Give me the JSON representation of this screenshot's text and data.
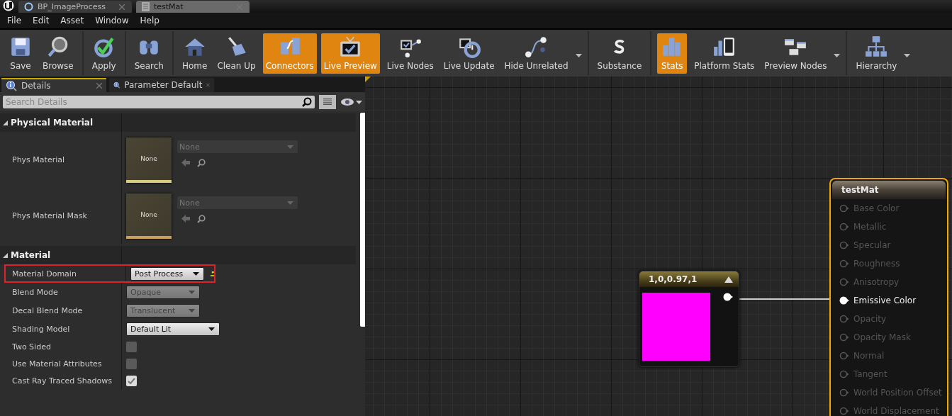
{
  "tabs": [
    {
      "label": "BP_ImageProcess",
      "selected": false
    },
    {
      "label": "testMat",
      "selected": true
    }
  ],
  "menu": [
    "File",
    "Edit",
    "Asset",
    "Window",
    "Help"
  ],
  "toolbar": [
    [
      {
        "label": "Save",
        "active": false,
        "dropdown": false
      },
      {
        "label": "Browse",
        "active": false,
        "dropdown": false
      }
    ],
    [
      {
        "label": "Apply",
        "active": false,
        "dropdown": false
      }
    ],
    [
      {
        "label": "Search",
        "active": false,
        "dropdown": false
      }
    ],
    [
      {
        "label": "Home",
        "active": false,
        "dropdown": false
      },
      {
        "label": "Clean Up",
        "active": false,
        "dropdown": false
      },
      {
        "label": "Connectors",
        "active": true,
        "dropdown": false
      },
      {
        "label": "Live Preview",
        "active": true,
        "dropdown": false
      },
      {
        "label": "Live Nodes",
        "active": false,
        "dropdown": false
      },
      {
        "label": "Live Update",
        "active": false,
        "dropdown": false
      },
      {
        "label": "Hide Unrelated",
        "active": false,
        "dropdown": true
      }
    ],
    [
      {
        "label": "Substance",
        "active": false,
        "dropdown": false
      }
    ],
    [
      {
        "label": "Stats",
        "active": true,
        "dropdown": false
      },
      {
        "label": "Platform Stats",
        "active": false,
        "dropdown": false
      },
      {
        "label": "Preview Nodes",
        "active": false,
        "dropdown": true
      }
    ],
    [
      {
        "label": "Hierarchy",
        "active": false,
        "dropdown": true
      }
    ]
  ],
  "details": {
    "tabs": [
      {
        "label": "Details",
        "selected": true
      },
      {
        "label": "Parameter Default",
        "selected": false
      }
    ],
    "search": {
      "placeholder": "Search Details"
    },
    "sections": [
      {
        "title": "Physical Material",
        "expanded": true,
        "rows": [
          {
            "kind": "asset",
            "label": "Phys Material",
            "thumb_label": "None",
            "value": "None",
            "color": "#d8cc80"
          },
          {
            "kind": "asset",
            "label": "Phys Material Mask",
            "thumb_label": "None",
            "value": "None",
            "color": "#c9a060"
          }
        ]
      },
      {
        "title": "Material",
        "expanded": true,
        "rows": [
          {
            "kind": "combo",
            "label": "Material Domain",
            "value": "Post Process",
            "disabled": false,
            "highlighted": true,
            "reset": true
          },
          {
            "kind": "combo",
            "label": "Blend Mode",
            "value": "Opaque",
            "disabled": true,
            "highlighted": false,
            "reset": false
          },
          {
            "kind": "combo",
            "label": "Decal Blend Mode",
            "value": "Translucent",
            "disabled": true,
            "highlighted": false,
            "reset": false
          },
          {
            "kind": "combo",
            "label": "Shading Model",
            "value": "Default Lit",
            "disabled": false,
            "highlighted": false,
            "reset": false,
            "wide": true
          },
          {
            "kind": "checkbox",
            "label": "Two Sided",
            "checked": false
          },
          {
            "kind": "checkbox",
            "label": "Use Material Attributes",
            "checked": false
          },
          {
            "kind": "checkbox",
            "label": "Cast Ray Traced Shadows",
            "checked": true
          }
        ]
      }
    ]
  },
  "graph": {
    "constant_node": {
      "title": "1,0,0.97,1",
      "color": "#ff00ff"
    },
    "material_node": {
      "title": "testMat",
      "pins": [
        {
          "label": "Base Color",
          "connected": false
        },
        {
          "label": "Metallic",
          "connected": false
        },
        {
          "label": "Specular",
          "connected": false
        },
        {
          "label": "Roughness",
          "connected": false
        },
        {
          "label": "Anisotropy",
          "connected": false
        },
        {
          "label": "Emissive Color",
          "connected": true
        },
        {
          "label": "Opacity",
          "connected": false
        },
        {
          "label": "Opacity Mask",
          "connected": false
        },
        {
          "label": "Normal",
          "connected": false
        },
        {
          "label": "Tangent",
          "connected": false
        },
        {
          "label": "World Position Offset",
          "connected": false
        },
        {
          "label": "World Displacement",
          "connected": false
        }
      ]
    }
  }
}
